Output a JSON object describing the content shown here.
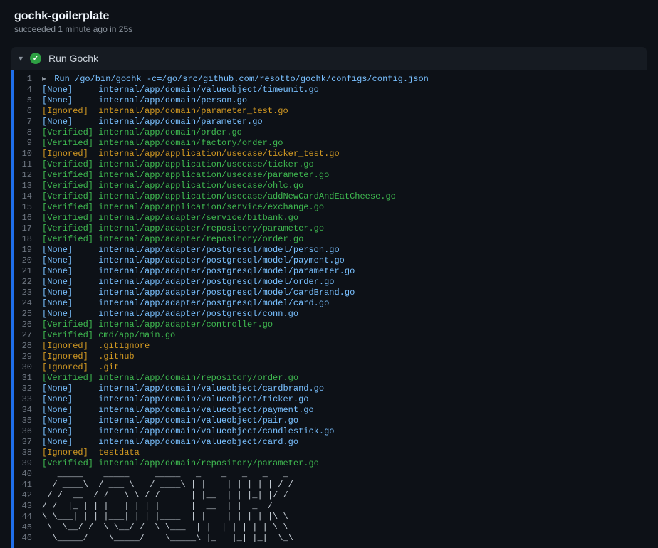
{
  "header": {
    "title": "gochk-goilerplate",
    "subtitle": "succeeded 1 minute ago in 25s"
  },
  "step": {
    "name": "Run Gochk"
  },
  "runCommand": "Run /go/bin/gochk -c=/go/src/github.com/resotto/gochk/configs/config.json",
  "lines": [
    {
      "n": 1,
      "type": "cmd"
    },
    {
      "n": 4,
      "type": "entry",
      "tag": "None",
      "path": "internal/app/domain/valueobject/timeunit.go"
    },
    {
      "n": 5,
      "type": "entry",
      "tag": "None",
      "path": "internal/app/domain/person.go"
    },
    {
      "n": 6,
      "type": "entry",
      "tag": "Ignored",
      "path": "internal/app/domain/parameter_test.go"
    },
    {
      "n": 7,
      "type": "entry",
      "tag": "None",
      "path": "internal/app/domain/parameter.go"
    },
    {
      "n": 8,
      "type": "entry",
      "tag": "Verified",
      "path": "internal/app/domain/order.go"
    },
    {
      "n": 9,
      "type": "entry",
      "tag": "Verified",
      "path": "internal/app/domain/factory/order.go"
    },
    {
      "n": 10,
      "type": "entry",
      "tag": "Ignored",
      "path": "internal/app/application/usecase/ticker_test.go"
    },
    {
      "n": 11,
      "type": "entry",
      "tag": "Verified",
      "path": "internal/app/application/usecase/ticker.go"
    },
    {
      "n": 12,
      "type": "entry",
      "tag": "Verified",
      "path": "internal/app/application/usecase/parameter.go"
    },
    {
      "n": 13,
      "type": "entry",
      "tag": "Verified",
      "path": "internal/app/application/usecase/ohlc.go"
    },
    {
      "n": 14,
      "type": "entry",
      "tag": "Verified",
      "path": "internal/app/application/usecase/addNewCardAndEatCheese.go"
    },
    {
      "n": 15,
      "type": "entry",
      "tag": "Verified",
      "path": "internal/app/application/service/exchange.go"
    },
    {
      "n": 16,
      "type": "entry",
      "tag": "Verified",
      "path": "internal/app/adapter/service/bitbank.go"
    },
    {
      "n": 17,
      "type": "entry",
      "tag": "Verified",
      "path": "internal/app/adapter/repository/parameter.go"
    },
    {
      "n": 18,
      "type": "entry",
      "tag": "Verified",
      "path": "internal/app/adapter/repository/order.go"
    },
    {
      "n": 19,
      "type": "entry",
      "tag": "None",
      "path": "internal/app/adapter/postgresql/model/person.go"
    },
    {
      "n": 20,
      "type": "entry",
      "tag": "None",
      "path": "internal/app/adapter/postgresql/model/payment.go"
    },
    {
      "n": 21,
      "type": "entry",
      "tag": "None",
      "path": "internal/app/adapter/postgresql/model/parameter.go"
    },
    {
      "n": 22,
      "type": "entry",
      "tag": "None",
      "path": "internal/app/adapter/postgresql/model/order.go"
    },
    {
      "n": 23,
      "type": "entry",
      "tag": "None",
      "path": "internal/app/adapter/postgresql/model/cardBrand.go"
    },
    {
      "n": 24,
      "type": "entry",
      "tag": "None",
      "path": "internal/app/adapter/postgresql/model/card.go"
    },
    {
      "n": 25,
      "type": "entry",
      "tag": "None",
      "path": "internal/app/adapter/postgresql/conn.go"
    },
    {
      "n": 26,
      "type": "entry",
      "tag": "Verified",
      "path": "internal/app/adapter/controller.go"
    },
    {
      "n": 27,
      "type": "entry",
      "tag": "Verified",
      "path": "cmd/app/main.go"
    },
    {
      "n": 28,
      "type": "entry",
      "tag": "Ignored",
      "path": ".gitignore"
    },
    {
      "n": 29,
      "type": "entry",
      "tag": "Ignored",
      "path": ".github"
    },
    {
      "n": 30,
      "type": "entry",
      "tag": "Ignored",
      "path": ".git"
    },
    {
      "n": 31,
      "type": "entry",
      "tag": "Verified",
      "path": "internal/app/domain/repository/order.go"
    },
    {
      "n": 32,
      "type": "entry",
      "tag": "None",
      "path": "internal/app/domain/valueobject/cardbrand.go"
    },
    {
      "n": 33,
      "type": "entry",
      "tag": "None",
      "path": "internal/app/domain/valueobject/ticker.go"
    },
    {
      "n": 34,
      "type": "entry",
      "tag": "None",
      "path": "internal/app/domain/valueobject/payment.go"
    },
    {
      "n": 35,
      "type": "entry",
      "tag": "None",
      "path": "internal/app/domain/valueobject/pair.go"
    },
    {
      "n": 36,
      "type": "entry",
      "tag": "None",
      "path": "internal/app/domain/valueobject/candlestick.go"
    },
    {
      "n": 37,
      "type": "entry",
      "tag": "None",
      "path": "internal/app/domain/valueobject/card.go"
    },
    {
      "n": 38,
      "type": "entry",
      "tag": "Ignored",
      "path": "testdata"
    },
    {
      "n": 39,
      "type": "entry",
      "tag": "Verified",
      "path": "internal/app/domain/repository/parameter.go"
    },
    {
      "n": 40,
      "type": "ascii",
      "text": "   _____    _____     _____   _    _   _   _   _    "
    },
    {
      "n": 41,
      "type": "ascii",
      "text": "  / ____\\  / ___ \\   / ____\\ | |  | | | | | | / /   "
    },
    {
      "n": 42,
      "type": "ascii",
      "text": " / /  __  / /   \\ \\ / /      | |__| | | |_| |/ /    "
    },
    {
      "n": 43,
      "type": "ascii",
      "text": "/ /  |_ | | |   | | | |      |  __  | |  _  /       "
    },
    {
      "n": 44,
      "type": "ascii",
      "text": "\\ \\___| | | |___| | | |____  | |  | | | | | |\\ \\    "
    },
    {
      "n": 45,
      "type": "ascii",
      "text": " \\  \\__/ /  \\ \\__/ /  \\ \\___  | |  | | | | | \\ \\   "
    },
    {
      "n": 46,
      "type": "ascii",
      "text": "  \\_____/    \\_____/    \\_____\\ |_|  |_| |_|  \\_\\  "
    }
  ]
}
